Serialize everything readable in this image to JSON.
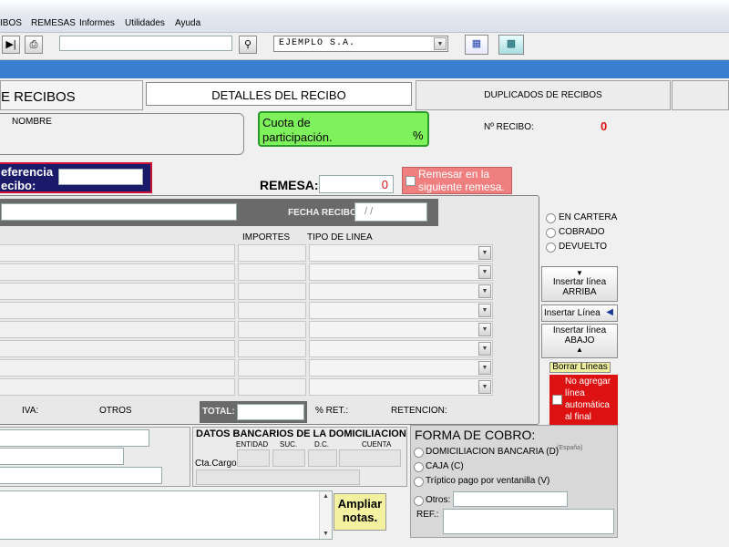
{
  "menu": {
    "recibos": "IBOS",
    "remesas": "REMESAS",
    "informes": "Informes",
    "utilidades": "Utilidades",
    "ayuda": "Ayuda"
  },
  "toolbar": {
    "company_value": "EJEMPLO S.A."
  },
  "tabs": {
    "recibos": "E RECIBOS",
    "detalles": "DETALLES DEL RECIBO",
    "duplicados": "DUPLICADOS DE RECIBOS"
  },
  "top": {
    "nombre_label": "NOMBRE",
    "cuota_line1": "Cuota de",
    "cuota_line2": "participación.",
    "cuota_pct": "%",
    "nrecibo_label": "Nº RECIBO:",
    "nrecibo_value": "0",
    "ref_line1": "eferencia",
    "ref_line2": "ecibo:",
    "remesa_label": "REMESA:",
    "remesa_value": "0",
    "remesar_line1": "Remesar en la",
    "remesar_line2": "siguiente remesa."
  },
  "lines": {
    "fecha_label": "FECHA RECIBO",
    "fecha_value": "/ /",
    "importes_header": "IMPORTES",
    "tipo_header": "TIPO DE LINEA",
    "iva_label": "IVA:",
    "otros_label": "OTROS",
    "total_label": "TOTAL:",
    "ret_pct_label": "% RET.:",
    "retencion_label": "RETENCION:"
  },
  "status": {
    "cartera": "EN CARTERA",
    "cobrado": "COBRADO",
    "devuelto": "DEVUELTO"
  },
  "actions": {
    "arriba_line1": "Insertar línea",
    "arriba_line2": "ARRIBA",
    "insertar": "Insertar Línea",
    "abajo_line1": "Insertar línea",
    "abajo_line2": "ABAJO",
    "borrar": "Borrar Líneas",
    "noagregar_1": "No agregar",
    "noagregar_2": "línea",
    "noagregar_3": "automática",
    "noagregar_4": "al final"
  },
  "bank": {
    "title": "DATOS BANCARIOS DE LA DOMICILIACION",
    "entidad": "ENTIDAD",
    "suc": "SUC.",
    "dc": "D.C.",
    "cuenta": "CUENTA",
    "cta_cargo": "Cta.Cargo"
  },
  "cobro": {
    "title": "FORMA DE COBRO:",
    "domiciliacion": "DOMICILIACION BANCARIA (D)",
    "espana": "(España)",
    "caja": "CAJA (C)",
    "triptico": "Tríptico pago por ventanilla (V)",
    "otros": "Otros:",
    "ref": "REF.:"
  },
  "notes": {
    "ampliar_line1": "Ampliar",
    "ampliar_line2": "notas."
  },
  "colors": {
    "band": "#3a7fcf",
    "green": "#7ef25a",
    "red": "#dd1111",
    "pink": "#f08080",
    "navy": "#1a1a6a"
  }
}
